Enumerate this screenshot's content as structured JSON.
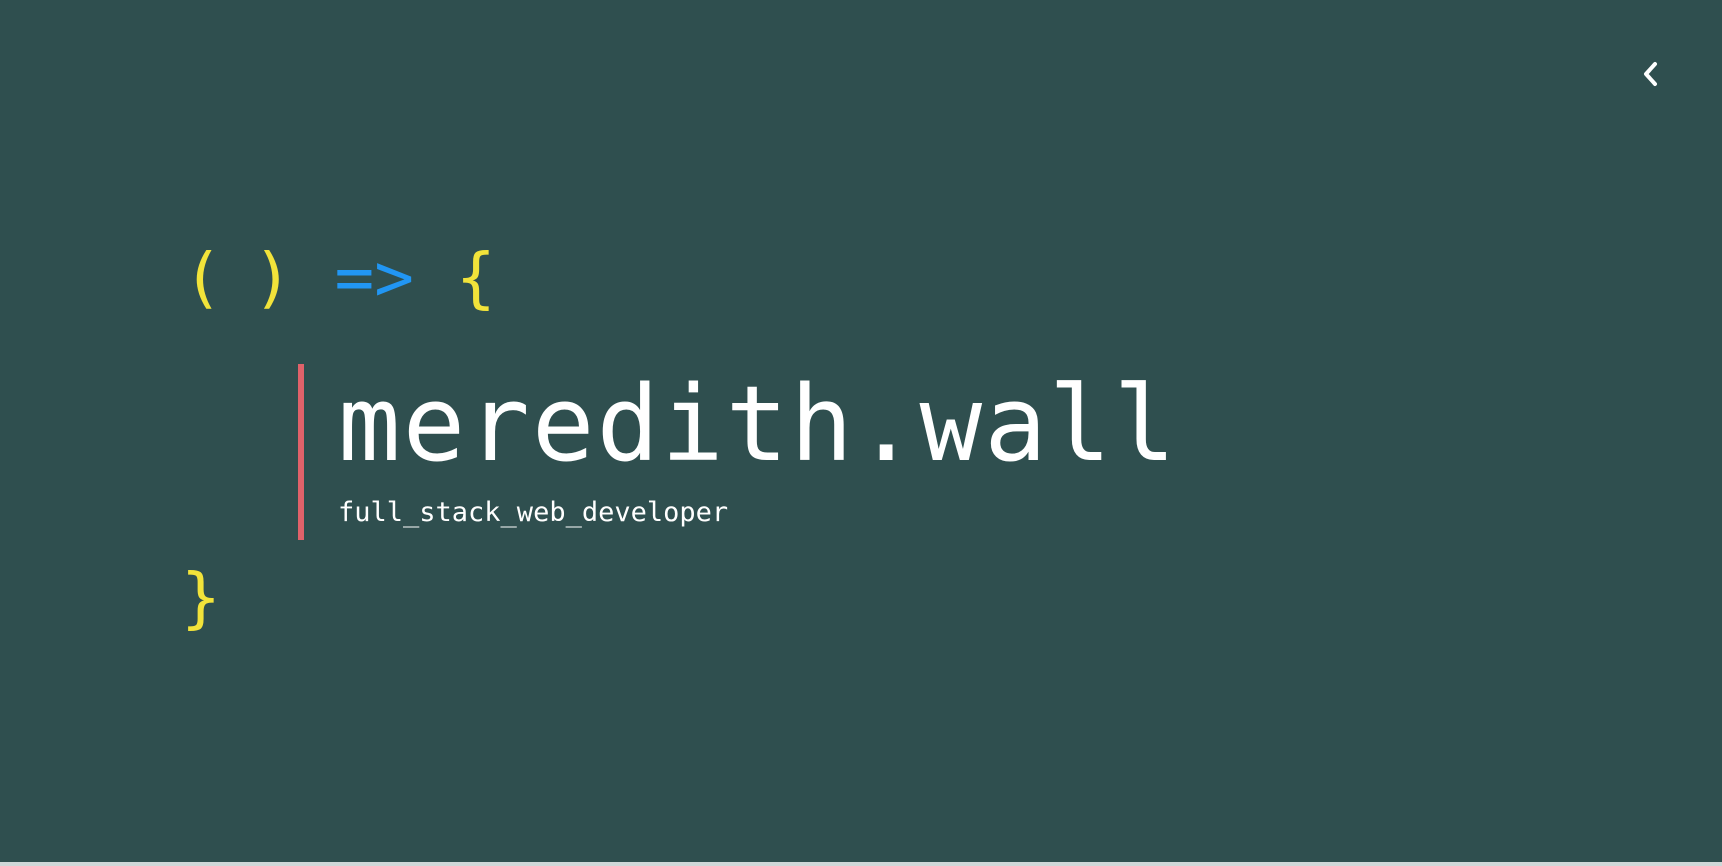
{
  "hero": {
    "open_paren": "(",
    "close_paren": ")",
    "arrow": "=>",
    "open_brace": "{",
    "close_brace": "}",
    "name": "meredith.wall",
    "role": "full_stack_web_developer"
  },
  "nav": {
    "toggle_icon": "chevron-left-icon"
  },
  "colors": {
    "background": "#2f4f4f",
    "punctuation": "#f2e33a",
    "arrow": "#2196f3",
    "accent_bar": "#e0626a",
    "text": "#ffffff"
  }
}
